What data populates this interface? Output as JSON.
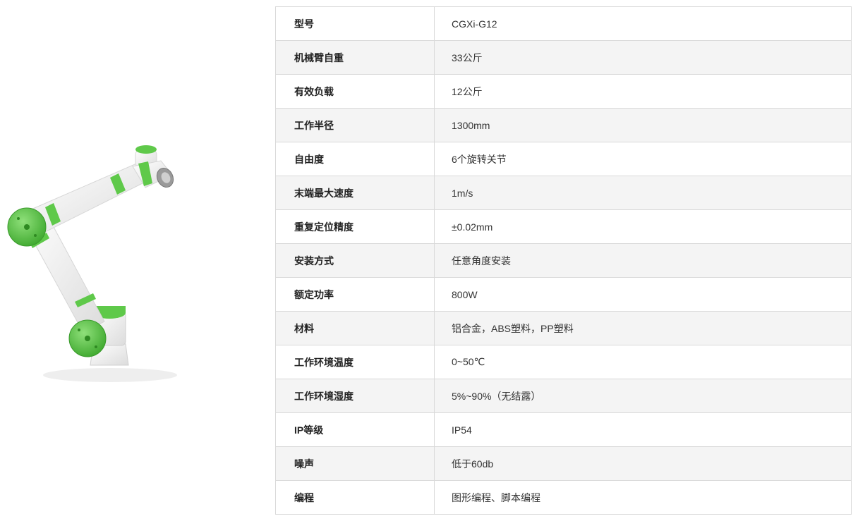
{
  "specs": [
    {
      "label": "型号",
      "value": "CGXi-G12"
    },
    {
      "label": "机械臂自重",
      "value": "33公斤"
    },
    {
      "label": "有效负载",
      "value": "12公斤"
    },
    {
      "label": "工作半径",
      "value": "1300mm"
    },
    {
      "label": "自由度",
      "value": "6个旋转关节"
    },
    {
      "label": "末端最大速度",
      "value": "1m/s"
    },
    {
      "label": "重复定位精度",
      "value": "±0.02mm"
    },
    {
      "label": "安装方式",
      "value": "任意角度安装"
    },
    {
      "label": "额定功率",
      "value": "800W"
    },
    {
      "label": "材料",
      "value": "铝合金，ABS塑料，PP塑料"
    },
    {
      "label": "工作环境温度",
      "value": "0~50℃"
    },
    {
      "label": "工作环境湿度",
      "value": "5%~90%（无结露）"
    },
    {
      "label": "IP等级",
      "value": "IP54"
    },
    {
      "label": "噪声",
      "value": "低于60db"
    },
    {
      "label": "编程",
      "value": "图形编程、脚本编程"
    }
  ],
  "colors": {
    "accent_green": "#5fc94a",
    "robot_body": "#f2f2f2",
    "row_alt_bg": "#f4f4f4",
    "border": "#d9d9d9"
  }
}
